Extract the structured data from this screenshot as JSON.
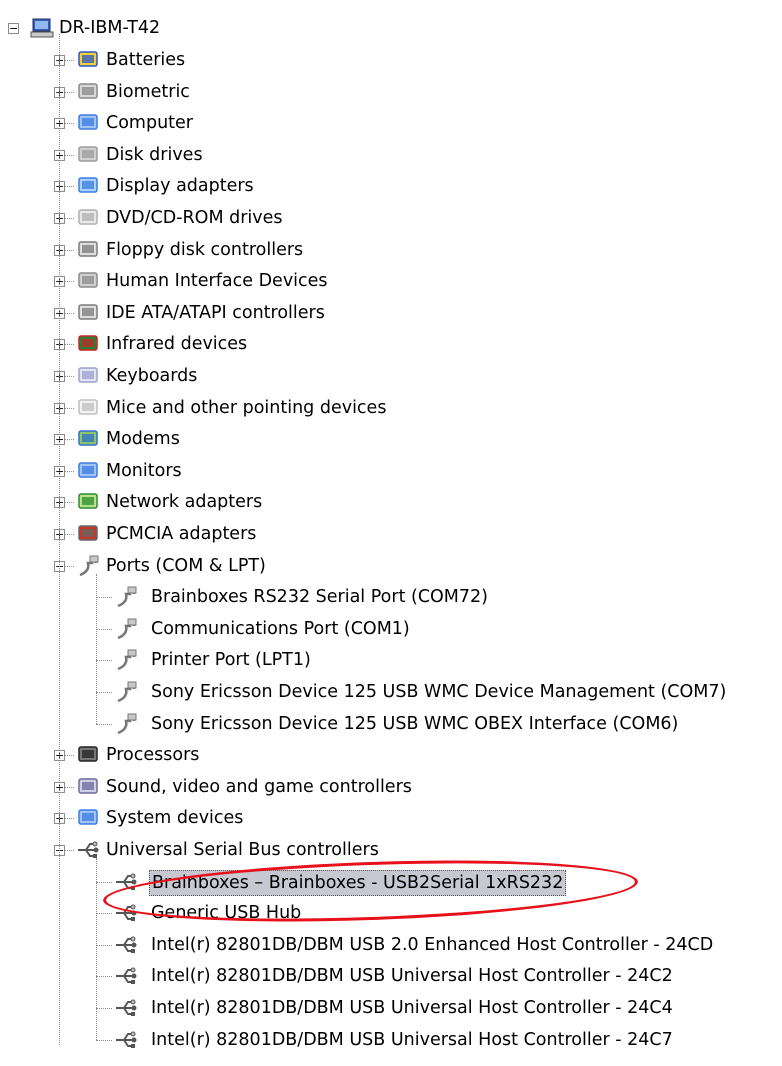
{
  "root": {
    "label": "DR-IBM-T42",
    "expanded": true,
    "icon": "computer-icon"
  },
  "categories": [
    {
      "label": "Batteries",
      "icon": "battery-icon",
      "expanded": false
    },
    {
      "label": "Biometric",
      "icon": "biometric-icon",
      "expanded": false
    },
    {
      "label": "Computer",
      "icon": "computer-icon",
      "expanded": false
    },
    {
      "label": "Disk drives",
      "icon": "disk-drive-icon",
      "expanded": false
    },
    {
      "label": "Display adapters",
      "icon": "display-adapter-icon",
      "expanded": false
    },
    {
      "label": "DVD/CD-ROM drives",
      "icon": "dvd-icon",
      "expanded": false
    },
    {
      "label": "Floppy disk controllers",
      "icon": "floppy-controller-icon",
      "expanded": false
    },
    {
      "label": "Human Interface Devices",
      "icon": "hid-icon",
      "expanded": false
    },
    {
      "label": "IDE ATA/ATAPI controllers",
      "icon": "ide-controller-icon",
      "expanded": false
    },
    {
      "label": "Infrared devices",
      "icon": "infrared-icon",
      "expanded": false
    },
    {
      "label": "Keyboards",
      "icon": "keyboard-icon",
      "expanded": false
    },
    {
      "label": "Mice and other pointing devices",
      "icon": "mouse-icon",
      "expanded": false
    },
    {
      "label": "Modems",
      "icon": "modem-icon",
      "expanded": false
    },
    {
      "label": "Monitors",
      "icon": "monitor-icon",
      "expanded": false
    },
    {
      "label": "Network adapters",
      "icon": "network-adapter-icon",
      "expanded": false
    },
    {
      "label": "PCMCIA adapters",
      "icon": "pcmcia-icon",
      "expanded": false
    },
    {
      "label": "Ports (COM & LPT)",
      "icon": "port-icon",
      "expanded": true,
      "children": [
        "Brainboxes RS232 Serial Port (COM72)",
        "Communications Port (COM1)",
        "Printer Port (LPT1)",
        "Sony Ericsson Device 125 USB WMC Device Management (COM7)",
        "Sony Ericsson Device 125 USB WMC OBEX Interface (COM6)"
      ]
    },
    {
      "label": "Processors",
      "icon": "processor-icon",
      "expanded": false
    },
    {
      "label": "Sound, video and game controllers",
      "icon": "sound-icon",
      "expanded": false
    },
    {
      "label": "System devices",
      "icon": "system-icon",
      "expanded": false
    },
    {
      "label": "Universal Serial Bus controllers",
      "icon": "usb-icon",
      "expanded": true,
      "children": [
        "Brainboxes – Brainboxes - USB2Serial 1xRS232",
        "Generic USB Hub",
        "Intel(r) 82801DB/DBM USB 2.0 Enhanced Host Controller - 24CD",
        "Intel(r) 82801DB/DBM USB Universal Host Controller - 24C2",
        "Intel(r) 82801DB/DBM USB Universal Host Controller - 24C4",
        "Intel(r) 82801DB/DBM USB Universal Host Controller - 24C7"
      ]
    }
  ],
  "selected": "Brainboxes – Brainboxes - USB2Serial 1xRS232",
  "highlight_color": "#e8101a"
}
